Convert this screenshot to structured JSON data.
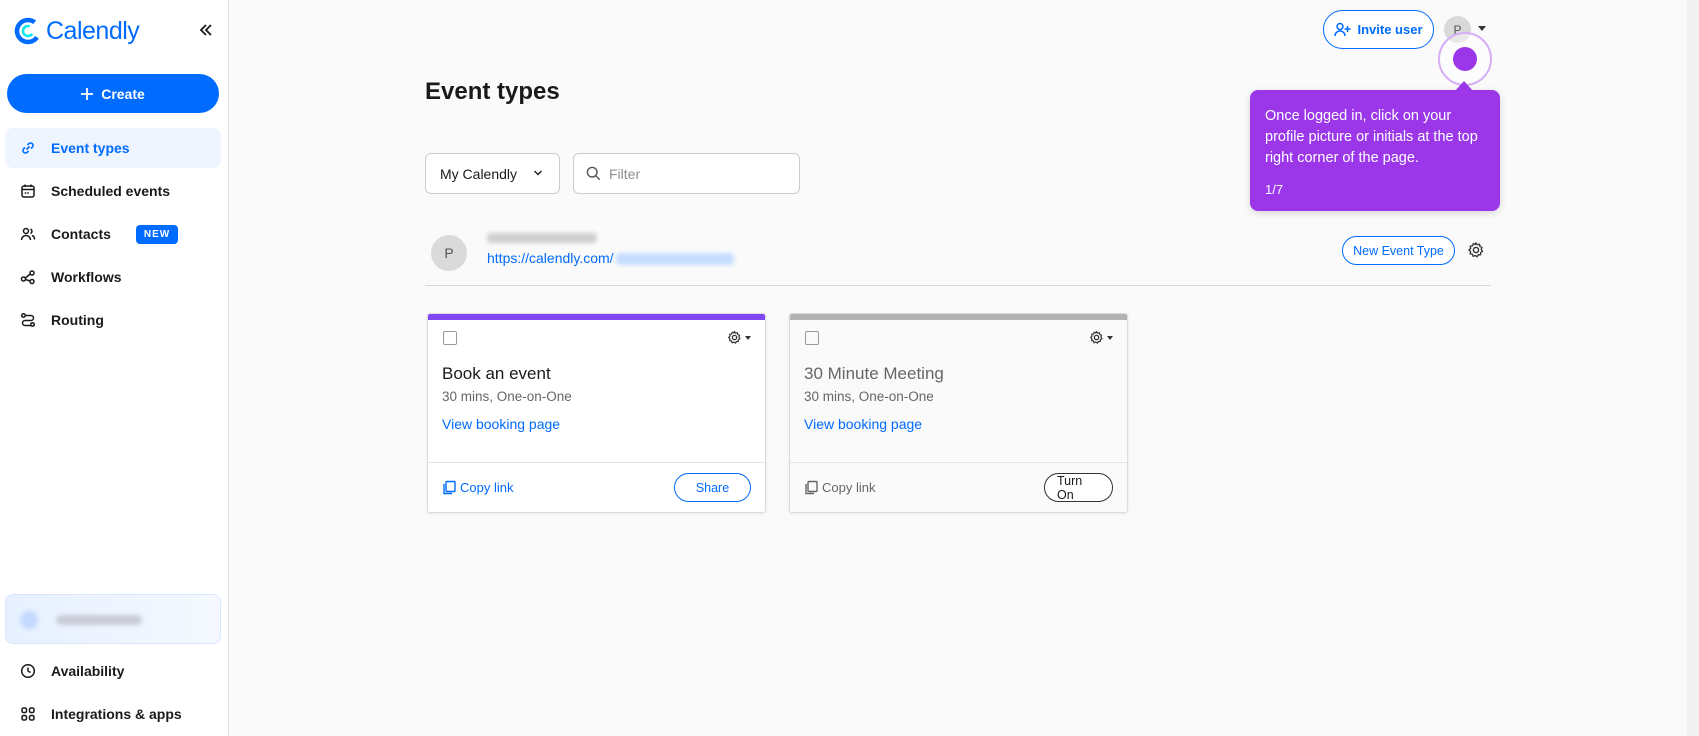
{
  "sidebar": {
    "brand": "Calendly",
    "create_label": "Create",
    "items": [
      {
        "label": "Event types"
      },
      {
        "label": "Scheduled events"
      },
      {
        "label": "Contacts",
        "badge": "NEW"
      },
      {
        "label": "Workflows"
      },
      {
        "label": "Routing"
      }
    ],
    "bottom_items": [
      {
        "label": "Availability"
      },
      {
        "label": "Integrations & apps"
      }
    ]
  },
  "header": {
    "invite_label": "Invite user",
    "avatar_initial": "P"
  },
  "tooltip": {
    "text": "Once logged in, click on your profile picture or initials at the top right corner of the page.",
    "step": "1/7"
  },
  "main": {
    "title": "Event types",
    "select_value": "My Calendly",
    "filter_placeholder": "Filter",
    "user": {
      "initial": "P",
      "link": "https://calendly.com/"
    },
    "new_event_label": "New Event Type",
    "cards": [
      {
        "title": "Book an event",
        "meta": "30 mins, One-on-One",
        "view_link": "View booking page",
        "copy_label": "Copy link",
        "action": "Share"
      },
      {
        "title": "30 Minute Meeting",
        "meta": "30 mins, One-on-One",
        "view_link": "View booking page",
        "copy_label": "Copy link",
        "action": "Turn On"
      }
    ]
  },
  "colors": {
    "brand_blue": "#006bff",
    "tooltip_purple": "#9b37e8",
    "card1_accent": "#8247f5",
    "card2_accent": "#b3b3b3"
  }
}
